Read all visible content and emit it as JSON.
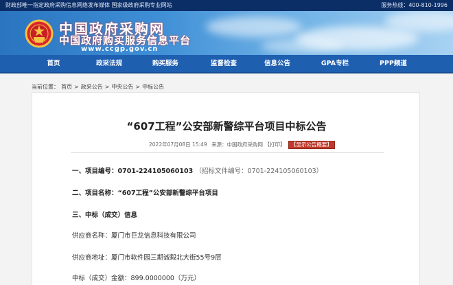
{
  "topbar": {
    "notice": "财政部唯一指定政府采购信息网络发布媒体 国家级政府采购专业网站",
    "phone": "服务热线：400-810-1996"
  },
  "banner": {
    "title_cn": "中国政府采购网",
    "title_cn2": "中国政府购买服务信息平台",
    "url": "www.ccgp.gov.cn",
    "colors": {
      "banner_start": "#2a74c0",
      "banner_end": "#a8d2f2",
      "brand_red": "#c33"
    }
  },
  "nav": {
    "items": [
      {
        "label": "首页"
      },
      {
        "label": "政采法规"
      },
      {
        "label": "购买服务"
      },
      {
        "label": "监督检查"
      },
      {
        "label": "信息公告"
      },
      {
        "label": "GPA专栏"
      },
      {
        "label": "PPP频道"
      }
    ],
    "color": "#1f5fb0"
  },
  "breadcrumb": {
    "prefix": "当前位置：",
    "items": [
      "首页",
      "政采公告",
      "中央公告",
      "中标公告"
    ],
    "separator": ">"
  },
  "article": {
    "title": "“607工程”公安部新警综平台项目中标公告",
    "meta": {
      "datetime": "2022年07月08日 15:49",
      "source": "来源：中国政府采购网",
      "print": "【打印】",
      "summary_button": "【显示公告概要】"
    },
    "sections": [
      {
        "label": "一、项目编号：",
        "value": "0701-224105060103",
        "extra": "（招标文件编号：0701-224105060103）"
      },
      {
        "label": "二、项目名称：",
        "value": "“607工程”公安部新警综平台项目"
      },
      {
        "label": "三、中标（成交）信息"
      }
    ],
    "fields": [
      {
        "label": "供应商名称：",
        "value": "厦门市巨龙信息科技有限公司"
      },
      {
        "label": "供应商地址：",
        "value": "厦门市软件园三期诚毅北大街55号9层"
      },
      {
        "label": "中标（成交）金额：",
        "value": "899.0000000（万元）"
      }
    ]
  }
}
